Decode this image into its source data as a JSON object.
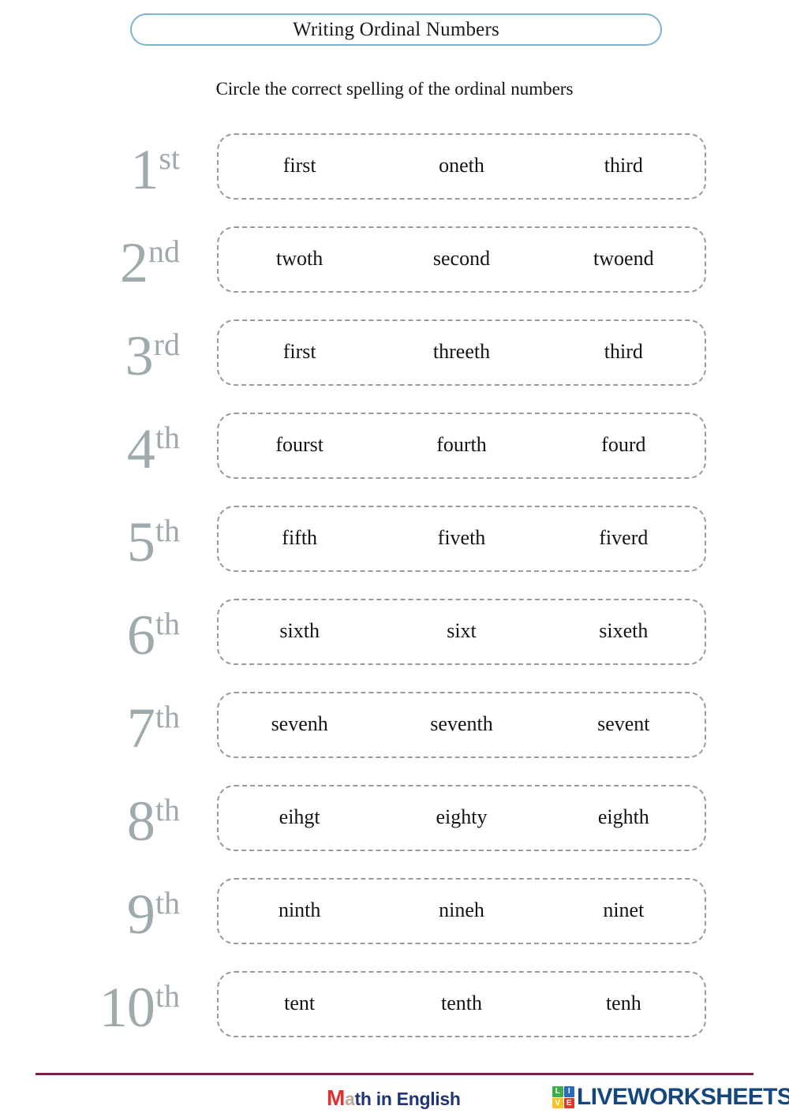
{
  "header": {
    "title": "Writing Ordinal Numbers",
    "title_border_color": "#7FB4CE"
  },
  "instruction": "Circle the correct spelling of the ordinal numbers",
  "exercise": {
    "ordinal_color": "#9FAAAC",
    "box_border_color": "#9A9A9A",
    "rows": [
      {
        "number": "1",
        "suffix": "st",
        "choices": [
          "first",
          "oneth",
          "third"
        ]
      },
      {
        "number": "2",
        "suffix": "nd",
        "choices": [
          "twoth",
          "second",
          "twoend"
        ]
      },
      {
        "number": "3",
        "suffix": "rd",
        "choices": [
          "first",
          "threeth",
          "third"
        ]
      },
      {
        "number": "4",
        "suffix": "th",
        "choices": [
          "fourst",
          "fourth",
          "fourd"
        ]
      },
      {
        "number": "5",
        "suffix": "th",
        "choices": [
          "fifth",
          "fiveth",
          "fiverd"
        ]
      },
      {
        "number": "6",
        "suffix": "th",
        "choices": [
          "sixth",
          "sixt",
          "sixeth"
        ]
      },
      {
        "number": "7",
        "suffix": "th",
        "choices": [
          "sevenh",
          "seventh",
          "sevent"
        ]
      },
      {
        "number": "8",
        "suffix": "th",
        "choices": [
          "eihgt",
          "eighty",
          "eighth"
        ]
      },
      {
        "number": "9",
        "suffix": "th",
        "choices": [
          "ninth",
          "nineh",
          "ninet"
        ]
      },
      {
        "number": "10",
        "suffix": "th",
        "choices": [
          "tent",
          "tenth",
          "tenh"
        ]
      }
    ]
  },
  "footer": {
    "rule_color": "#7B2448",
    "math_logo": {
      "m": "M",
      "a": "a",
      "rest": "th in English"
    },
    "liveworksheets_logo": {
      "squares": [
        "L",
        "I",
        "V",
        "E"
      ],
      "wordmark": "LIVEWORKSHEETS"
    }
  }
}
